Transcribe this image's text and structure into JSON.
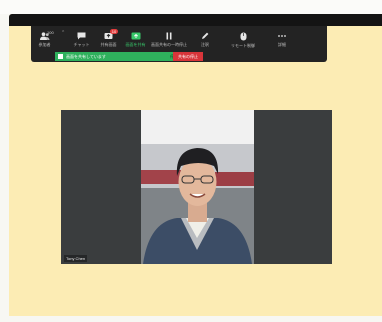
{
  "toolbar": {
    "participant_count": "100",
    "chat_badge": "10",
    "items": [
      {
        "label": "参加者",
        "icon": "participants-icon"
      },
      {
        "label": "チャット",
        "icon": "chat-icon"
      },
      {
        "label": "共有画面",
        "icon": "share-screen-icon"
      },
      {
        "label": "画面を共有",
        "icon": "share-screen-active-icon"
      },
      {
        "label": "画面共有の一時停止",
        "icon": "pause-icon"
      },
      {
        "label": "注釈",
        "icon": "annotate-icon"
      },
      {
        "label": "リモート制御",
        "icon": "remote-control-icon"
      },
      {
        "label": "詳細",
        "icon": "more-icon"
      }
    ]
  },
  "share_status": {
    "label": "画面を共有しています",
    "stop_label": "停止"
  },
  "stop_share": {
    "label": "共有の停止"
  },
  "video": {
    "participant_name": "Tony Chen"
  },
  "colors": {
    "desktop_background": "#fcecb4",
    "toolbar": "#232323",
    "share_green": "#2fb15d",
    "stop_red": "#d8353a",
    "video_panel": "#3a3d3e"
  }
}
